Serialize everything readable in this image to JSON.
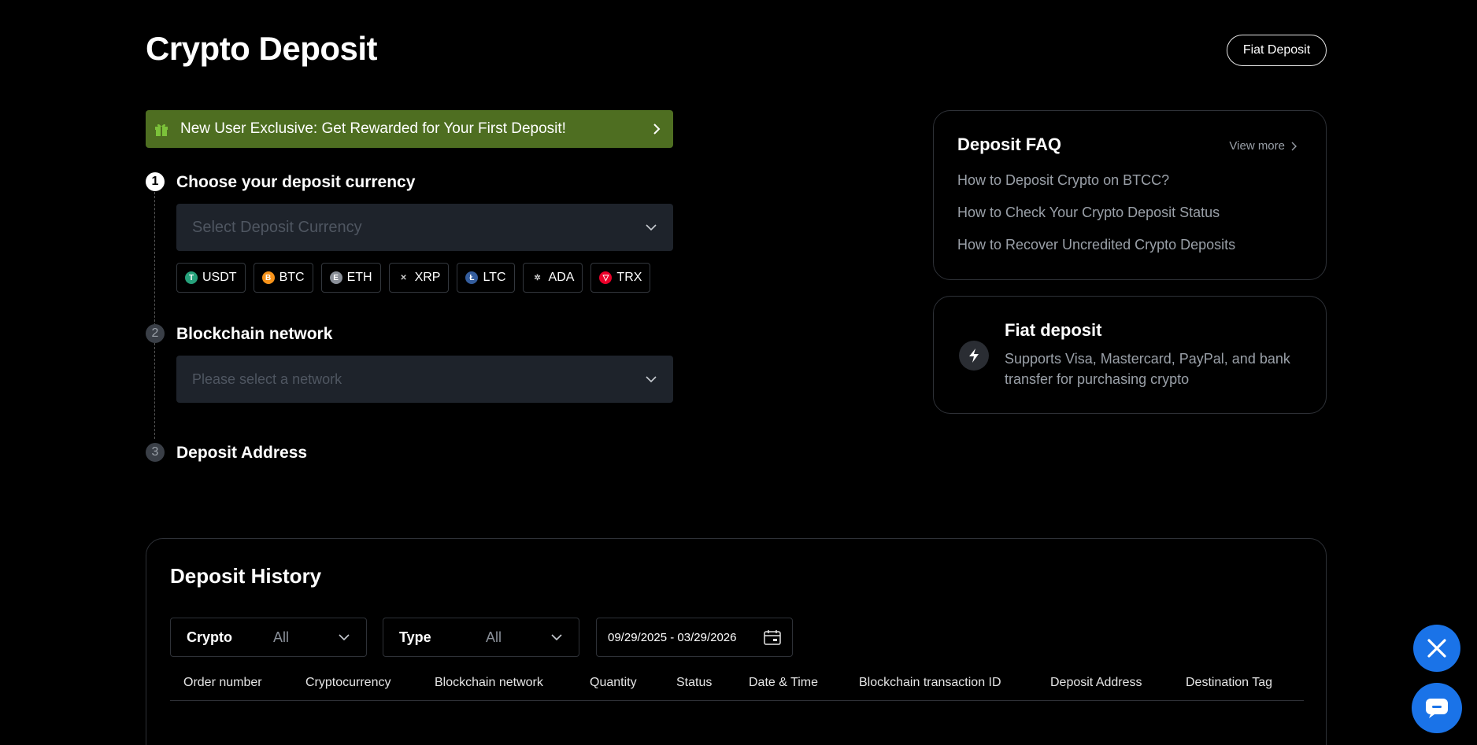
{
  "page": {
    "title": "Crypto Deposit",
    "fiat_button": "Fiat Deposit"
  },
  "promo": {
    "text": "New User Exclusive: Get Rewarded for Your First Deposit!"
  },
  "steps": [
    {
      "num": "1",
      "title": "Choose your deposit currency",
      "placeholder": "Select Deposit Currency"
    },
    {
      "num": "2",
      "title": "Blockchain network",
      "placeholder": "Please select a network"
    },
    {
      "num": "3",
      "title": "Deposit Address"
    }
  ],
  "currencies": [
    {
      "label": "USDT",
      "color": "#26a17b",
      "glyph": "T"
    },
    {
      "label": "BTC",
      "color": "#f7931a",
      "glyph": "B"
    },
    {
      "label": "ETH",
      "color": "#8a8f98",
      "glyph": "E"
    },
    {
      "label": "XRP",
      "color": "#000000",
      "glyph": "✕"
    },
    {
      "label": "LTC",
      "color": "#345d9d",
      "glyph": "Ł"
    },
    {
      "label": "ADA",
      "color": "#000000",
      "glyph": "✲"
    },
    {
      "label": "TRX",
      "color": "#eb0029",
      "glyph": "▽"
    }
  ],
  "faq": {
    "title": "Deposit FAQ",
    "view_more": "View more",
    "links": [
      "How to Deposit Crypto on BTCC?",
      "How to Check Your Crypto Deposit Status",
      "How to Recover Uncredited Crypto Deposits"
    ]
  },
  "fiat": {
    "title": "Fiat deposit",
    "desc": "Supports Visa, Mastercard, PayPal, and bank transfer for purchasing crypto"
  },
  "history": {
    "title": "Deposit History",
    "filters": {
      "crypto_label": "Crypto",
      "crypto_value": "All",
      "type_label": "Type",
      "type_value": "All",
      "date_range": "09/29/2025 - 03/29/2026"
    },
    "columns": [
      "Order number",
      "Cryptocurrency",
      "Blockchain network",
      "Quantity",
      "Status",
      "Date & Time",
      "Blockchain transaction ID",
      "Deposit Address",
      "Destination Tag"
    ]
  },
  "colors": {
    "promo_bg": "#4e6e21",
    "fab_bg": "#1a73e8",
    "muted": "#9aa0a8"
  }
}
